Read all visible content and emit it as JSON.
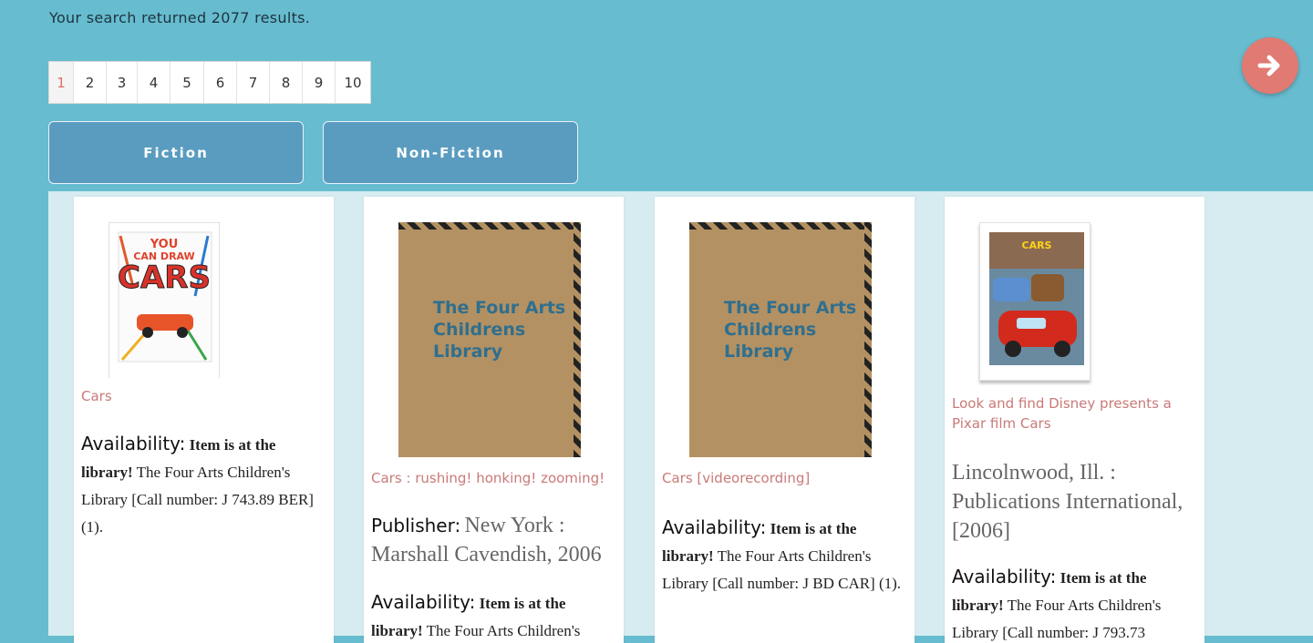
{
  "summary": "Your search returned 2077 results.",
  "pagination": [
    "1",
    "2",
    "3",
    "4",
    "5",
    "6",
    "7",
    "8",
    "9",
    "10"
  ],
  "active_page": "1",
  "filters": {
    "fiction": "Fiction",
    "nonfiction": "Non-Fiction"
  },
  "placeholder_cover_text": [
    "The Four Arts",
    "Childrens",
    "Library"
  ],
  "cover_cars_text": [
    "YOU",
    "CAN DRAW",
    "CARS"
  ],
  "labels": {
    "availability": "Availability",
    "publisher": "Publisher",
    "colon": ":"
  },
  "cards": [
    {
      "title": "Cars",
      "availability_bold": "Item is at the library!",
      "availability_text": " The Four Arts Children's Library [Call number: J 743.89 BER] (1)."
    },
    {
      "title": "Cars : rushing! honking! zooming!",
      "publisher": "New York : Marshall Cavendish, 2006",
      "availability_bold": "Item is at the library!",
      "availability_text": " The Four Arts Children's"
    },
    {
      "title": "Cars [videorecording]",
      "availability_bold": "Item is at the library!",
      "availability_text": " The Four Arts Children's Library [Call number: J BD CAR] (1)."
    },
    {
      "title": "Look and find Disney presents a Pixar film Cars",
      "publisher_value": "Lincolnwood, Ill. : Publications International, [2006]",
      "availability_bold": "Item is at the library!",
      "availability_text": " The Four Arts Children's Library [Call number: J 793.73"
    }
  ],
  "colors": {
    "header_bg": "#67bccf",
    "results_bg": "#d6ecf1",
    "filter_btn": "#5a9cc0",
    "next_btn": "#e07a72",
    "title_link": "#c97a78"
  }
}
